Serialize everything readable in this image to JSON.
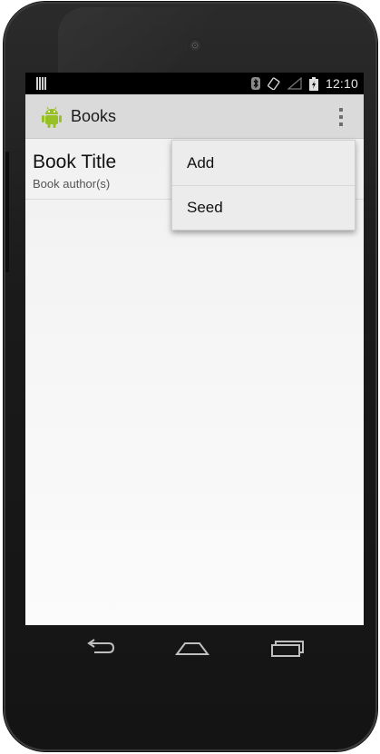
{
  "status_bar": {
    "time": "12:10"
  },
  "action_bar": {
    "title": "Books"
  },
  "list": [
    {
      "title": "Book Title",
      "author": "Book author(s)"
    }
  ],
  "overflow_menu": {
    "items": [
      {
        "label": "Add"
      },
      {
        "label": "Seed"
      }
    ]
  },
  "icons": {
    "app": "android-robot-icon",
    "overflow": "more-vert-icon",
    "status": [
      "notification-icon",
      "bluetooth-icon",
      "rotation-icon",
      "signal-icon",
      "battery-charging-icon"
    ],
    "nav": [
      "back-icon",
      "home-icon",
      "recent-apps-icon"
    ]
  },
  "colors": {
    "android_green": "#97c024",
    "action_bar": "#dadada",
    "status_bar": "#000000"
  }
}
